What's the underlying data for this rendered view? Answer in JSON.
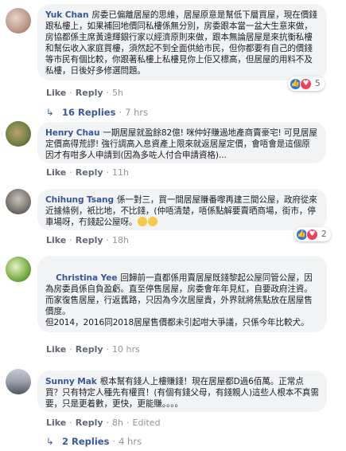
{
  "comments": [
    {
      "author": "Yuk Chan",
      "text": "房委已偏離居屋的思維，居屋原意是幫低下層買屋，現在價錢跟私樓上，如果補回地價同私樓係無分別，房委跟本當一盆大生意來做，房協都係主席黃遠輝銀行家以經濟原則來做，跟本無論居屋是來抗衡私樓和幫伝收入家庭買樓，須然起不到全面供給市民，但你都要有自己的價錢等市民有個比較，你跟著私樓上私樓見你上佢又標高，但居屋的用料不及私樓，日後好多修選問題。",
      "actions": {
        "like": "Like",
        "reply": "Reply",
        "time": "5h"
      },
      "reactions": {
        "count": "5"
      },
      "replies": {
        "label": "16 Replies",
        "time": "7 hrs"
      }
    },
    {
      "author": "Henry Chau",
      "text": "一期居屋就盈餘82億! 咪仲好賺過地產商賣豪宅! 可見居屋定價高得荒謬! 強行調高入息資產上限來就返居屋定價，會唔會是這個原因才有咁多人申請到(因為多咗人付合申請資格)...",
      "actions": {
        "like": "Like",
        "reply": "Reply",
        "time": "11h"
      }
    },
    {
      "author": "Chihung Tsang",
      "text": "係一對三，買一間居屋賺番嚟再建三間公屋，政府從來近據條例，衹比地，不比錢，(仲唔清楚，唔係點解要賣晒商場，街市，停車場呀，冇錢起公屋呀。",
      "actions": {
        "like": "Like",
        "reply": "Reply",
        "time": "18h"
      },
      "reactions": {
        "count": "2"
      }
    },
    {
      "author": "Christina Yee",
      "text": "回歸前一直都係用賣居屋既錢黎起公屋同管公屋，因為房委員係自負盈虧。直至停售居屋，房委會年年見紅，自要政府注資。而家復售居屋，行返舊路，只因為今次居屋貴，外界就將焦點放在居屋售價度。\n但2014，2016同2018居屋售價都未引起咁大爭議，只係今年比較犬。",
      "actions": {
        "like": "Like",
        "reply": "Reply",
        "time": "10 hrs"
      }
    },
    {
      "author": "Sunny Mak",
      "text": "根本幫有錢人上樓賺錢！現在居屋都D過6佰萬。正常点買？只有特定人種先有權買！(有個有錢父母，有錢親人)這些人根本不真需要，只是更着數，更快，更能賺。。。。",
      "actions": {
        "like": "Like",
        "reply": "Reply",
        "time": "8h",
        "edited": "Edited"
      },
      "replies": {
        "label": "2 Replies",
        "time": "4 hrs"
      }
    }
  ],
  "colors": {
    "link": "#385898",
    "bubble_bg": "#f2f3f5",
    "like_blue": "#2078f4",
    "love_red": "#f33e58"
  },
  "icons": [
    "like-icon",
    "love-icon",
    "reply-arrow-icon",
    "smile-emoji-icon"
  ]
}
